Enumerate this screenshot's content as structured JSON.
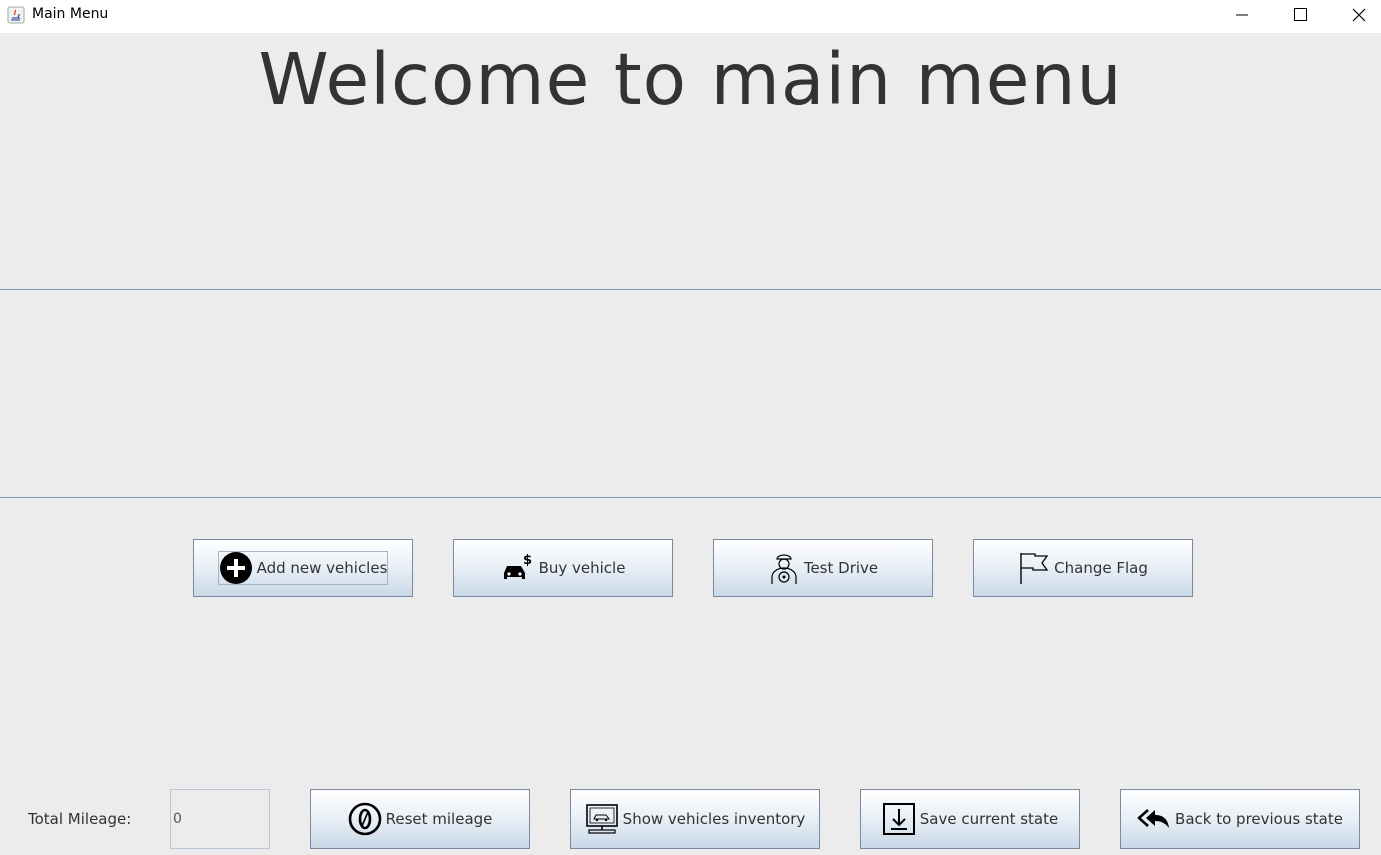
{
  "window": {
    "title": "Main Menu",
    "controls": {
      "minimize": "minimize-icon",
      "maximize": "maximize-icon",
      "close": "close-icon"
    }
  },
  "main": {
    "welcome": "Welcome to main menu"
  },
  "actions": {
    "add_vehicles": {
      "label": "Add new vehicles",
      "icon": "plus-circle-icon"
    },
    "buy_vehicle": {
      "label": "Buy vehicle",
      "icon": "car-dollar-icon"
    },
    "test_drive": {
      "label": "Test Drive",
      "icon": "driver-icon"
    },
    "change_flag": {
      "label": "Change Flag",
      "icon": "flag-icon"
    }
  },
  "footer": {
    "mileage_label": "Total Mileage:",
    "mileage_value": "0",
    "reset_mileage": {
      "label": "Reset mileage",
      "icon": "zero-circle-icon"
    },
    "show_inventory": {
      "label": "Show vehicles inventory",
      "icon": "monitor-car-icon"
    },
    "save_state": {
      "label": "Save current state",
      "icon": "download-icon"
    },
    "back_state": {
      "label": "Back to previous state",
      "icon": "reply-all-icon"
    }
  },
  "colors": {
    "background": "#ececec",
    "divider": "#7e94ad",
    "button_border": "#7a8aa0"
  }
}
